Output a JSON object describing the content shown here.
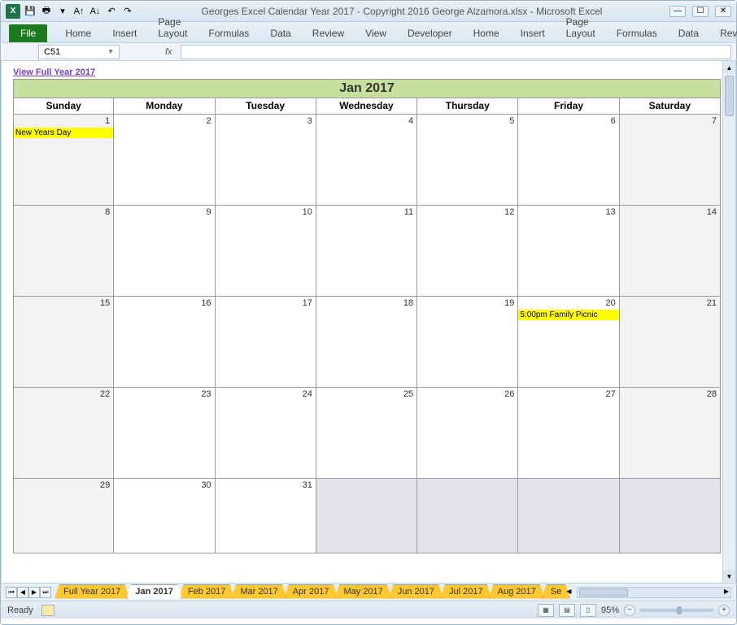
{
  "title": "Georges Excel Calendar Year 2017 - Copyright 2016 George Alzamora.xlsx  -  Microsoft Excel",
  "ribbon": {
    "file": "File",
    "tabs": [
      "Home",
      "Insert",
      "Page Layout",
      "Formulas",
      "Data",
      "Review",
      "View",
      "Developer"
    ]
  },
  "namebox": "C51",
  "fx": "fx",
  "view_link": "View Full Year 2017",
  "calendar": {
    "title": "Jan 2017",
    "dayheads": [
      "Sunday",
      "Monday",
      "Tuesday",
      "Wednesday",
      "Thursday",
      "Friday",
      "Saturday"
    ],
    "weeks": [
      [
        {
          "n": "1",
          "shade": true,
          "event": "New Years Day"
        },
        {
          "n": "2"
        },
        {
          "n": "3"
        },
        {
          "n": "4"
        },
        {
          "n": "5"
        },
        {
          "n": "6"
        },
        {
          "n": "7",
          "shade": true
        }
      ],
      [
        {
          "n": "8",
          "shade": true
        },
        {
          "n": "9"
        },
        {
          "n": "10"
        },
        {
          "n": "11"
        },
        {
          "n": "12"
        },
        {
          "n": "13"
        },
        {
          "n": "14",
          "shade": true
        }
      ],
      [
        {
          "n": "15",
          "shade": true
        },
        {
          "n": "16"
        },
        {
          "n": "17"
        },
        {
          "n": "18"
        },
        {
          "n": "19"
        },
        {
          "n": "20",
          "event": "5:00pm Family Picnic"
        },
        {
          "n": "21",
          "shade": true
        }
      ],
      [
        {
          "n": "22",
          "shade": true
        },
        {
          "n": "23"
        },
        {
          "n": "24"
        },
        {
          "n": "25"
        },
        {
          "n": "26"
        },
        {
          "n": "27"
        },
        {
          "n": "28",
          "shade": true
        }
      ],
      [
        {
          "n": "29",
          "shade": true
        },
        {
          "n": "30"
        },
        {
          "n": "31"
        },
        {
          "n": "",
          "last": true
        },
        {
          "n": "",
          "last": true
        },
        {
          "n": "",
          "last": true
        },
        {
          "n": "",
          "last": true
        }
      ]
    ]
  },
  "sheet_tabs": [
    "Full Year 2017",
    "Jan 2017",
    "Feb 2017",
    "Mar 2017",
    "Apr 2017",
    "May 2017",
    "Jun 2017",
    "Jul 2017",
    "Aug 2017",
    "Se"
  ],
  "active_tab_index": 1,
  "status": {
    "ready": "Ready",
    "zoom": "95%"
  }
}
